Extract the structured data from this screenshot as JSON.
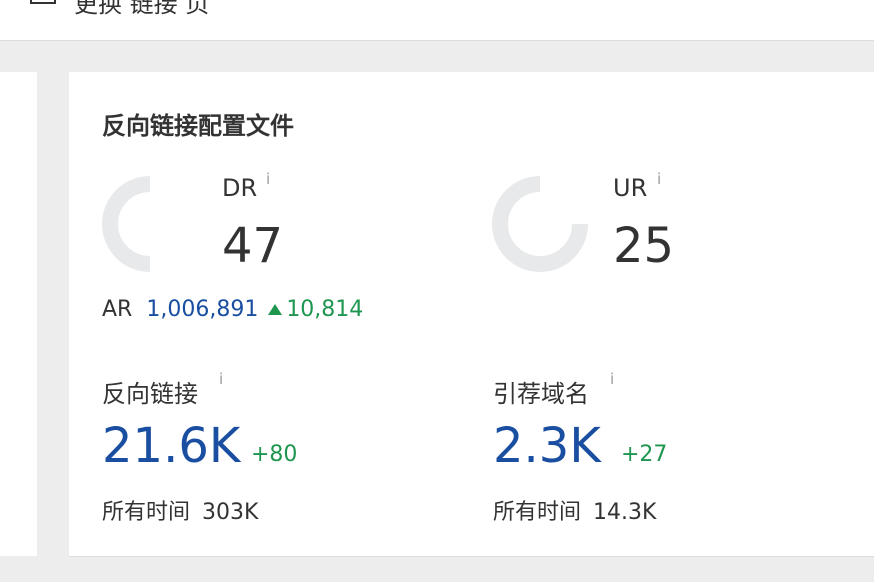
{
  "topbar": {
    "text": "更换 链接 页"
  },
  "card": {
    "title": "反向链接配置文件",
    "dr": {
      "label": "DR",
      "info": "i",
      "value": "47",
      "gauge_fraction": 0.47
    },
    "ur": {
      "label": "UR",
      "info": "i",
      "value": "25",
      "gauge_fraction": 0.25
    },
    "ar": {
      "label": "AR",
      "value": "1,006,891",
      "delta": "10,814"
    },
    "backlinks": {
      "label": "反向链接",
      "info": "i",
      "value": "21.6K",
      "delta": "+80",
      "alltime_label": "所有时间",
      "alltime_value": "303K"
    },
    "refdomains": {
      "label": "引荐域名",
      "info": "i",
      "value": "2.3K",
      "delta": "+27",
      "alltime_label": "所有时间",
      "alltime_value": "14.3K"
    }
  },
  "colors": {
    "accent_blue": "#1a4ea0",
    "positive_green": "#1e9650",
    "gauge_track": "#e8e9ea"
  }
}
